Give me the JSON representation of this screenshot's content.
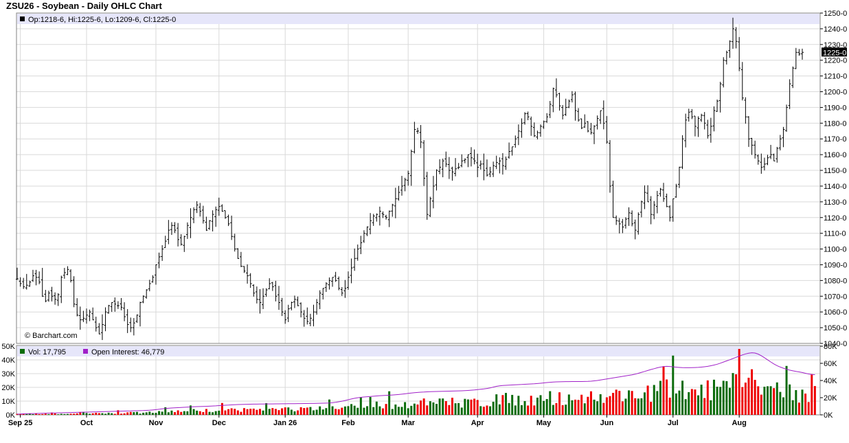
{
  "title": "ZSU26 - Soybean - Daily OHLC Chart",
  "colors": {
    "ohlc": "#000000",
    "volume_up": "#0a6b0a",
    "volume_down": "#ee0000",
    "open_interest": "#a020c8",
    "legend_bg": "#e6e6fa",
    "grid": "#d9d9d9",
    "last_price_bg": "#000000",
    "last_price_text": "#ffffff"
  },
  "price_panel": {
    "legend": "Op:1218-6, Hi:1225-6, Lo:1209-6, Cl:1225-0",
    "watermark": "© Barchart.com",
    "last_price_label": "1225-0",
    "ylim": [
      1040,
      1250
    ],
    "ticks": [
      "1040-0",
      "1050-0",
      "1060-0",
      "1070-0",
      "1080-0",
      "1090-0",
      "1100-0",
      "1110-0",
      "1120-0",
      "1130-0",
      "1140-0",
      "1150-0",
      "1160-0",
      "1170-0",
      "1180-0",
      "1190-0",
      "1200-0",
      "1210-0",
      "1220-0",
      "1230-0",
      "1240-0",
      "1250-0"
    ],
    "last_price": 1225
  },
  "volume_panel": {
    "vol_legend": "Vol: 17,795",
    "oi_legend": "Open Interest: 46,779",
    "left_ticks": [
      "0K",
      "10K",
      "20K",
      "30K",
      "40K",
      "50K"
    ],
    "right_ticks": [
      "0K",
      "20K",
      "40K",
      "60K",
      "80K"
    ],
    "vol_ylim": [
      0,
      50000
    ],
    "oi_ylim": [
      0,
      80000
    ]
  },
  "x_axis": {
    "labels": [
      "Sep 25",
      "Oct",
      "Nov",
      "Dec",
      "Jan 26",
      "Feb",
      "Mar",
      "Apr",
      "May",
      "Jun",
      "Jul",
      "Aug"
    ]
  },
  "chart_data": {
    "type": "ohlc",
    "title": "ZSU26 - Soybean - Daily OHLC Chart",
    "ylim": [
      1040,
      1250
    ],
    "grid": true,
    "legend_placement": "top-left",
    "month_start_index": {
      "Sep 25": 1,
      "Oct": 22,
      "Nov": 44,
      "Dec": 64,
      "Jan 26": 85,
      "Feb": 105,
      "Mar": 124,
      "Apr": 146,
      "May": 167,
      "Jun": 187,
      "Jul": 208,
      "Aug": 229
    },
    "close": [
      1081,
      1078,
      1076,
      1077,
      1079,
      1083,
      1082,
      1079,
      1070,
      1067,
      1072,
      1070,
      1068,
      1071,
      1082,
      1085,
      1087,
      1080,
      1065,
      1058,
      1055,
      1056,
      1058,
      1060,
      1055,
      1050,
      1046,
      1052,
      1060,
      1064,
      1066,
      1065,
      1064,
      1063,
      1057,
      1052,
      1050,
      1053,
      1058,
      1066,
      1070,
      1074,
      1078,
      1082,
      1090,
      1095,
      1100,
      1105,
      1112,
      1115,
      1112,
      1106,
      1103,
      1108,
      1115,
      1120,
      1125,
      1128,
      1124,
      1118,
      1112,
      1118,
      1122,
      1125,
      1127,
      1124,
      1120,
      1116,
      1108,
      1100,
      1094,
      1089,
      1086,
      1083,
      1078,
      1072,
      1068,
      1066,
      1070,
      1074,
      1078,
      1076,
      1070,
      1066,
      1060,
      1055,
      1062,
      1066,
      1068,
      1064,
      1060,
      1056,
      1054,
      1056,
      1060,
      1066,
      1072,
      1075,
      1078,
      1080,
      1082,
      1080,
      1075,
      1072,
      1075,
      1082,
      1088,
      1094,
      1100,
      1104,
      1110,
      1114,
      1118,
      1121,
      1122,
      1124,
      1122,
      1120,
      1124,
      1128,
      1132,
      1136,
      1140,
      1144,
      1148,
      1162,
      1176,
      1175,
      1168,
      1145,
      1122,
      1132,
      1140,
      1150,
      1152,
      1156,
      1154,
      1150,
      1149,
      1151,
      1152,
      1156,
      1157,
      1160,
      1158,
      1156,
      1152,
      1154,
      1150,
      1147,
      1149,
      1153,
      1155,
      1156,
      1153,
      1157,
      1162,
      1165,
      1170,
      1175,
      1180,
      1186,
      1184,
      1178,
      1172,
      1174,
      1178,
      1181,
      1184,
      1192,
      1202,
      1198,
      1191,
      1185,
      1190,
      1194,
      1198,
      1188,
      1182,
      1177,
      1180,
      1175,
      1174,
      1178,
      1183,
      1188,
      1180,
      1168,
      1140,
      1120,
      1118,
      1116,
      1114,
      1119,
      1123,
      1116,
      1112,
      1122,
      1130,
      1136,
      1130,
      1122,
      1128,
      1134,
      1138,
      1132,
      1127,
      1120,
      1132,
      1140,
      1152,
      1170,
      1182,
      1187,
      1184,
      1178,
      1183,
      1185,
      1180,
      1172,
      1178,
      1188,
      1194,
      1205,
      1220,
      1225,
      1232,
      1240,
      1232,
      1215,
      1196,
      1184,
      1170,
      1166,
      1160,
      1156,
      1152,
      1154,
      1158,
      1160,
      1156,
      1164,
      1170,
      1176,
      1190,
      1205,
      1215,
      1225,
      1224,
      1225
    ],
    "open_interest": [
      900,
      1000,
      1200,
      1300,
      1400,
      1500,
      1600,
      1700,
      1800,
      1900,
      2000,
      2100,
      2200,
      2300,
      2400,
      2500,
      2600,
      2700,
      2800,
      2900,
      3000,
      3100,
      3200,
      3300,
      3400,
      3500,
      3600,
      3700,
      3800,
      3900,
      4000,
      4100,
      4200,
      4300,
      4400,
      4500,
      4600,
      4700,
      4800,
      4900,
      5000,
      5200,
      5400,
      5700,
      6100,
      6500,
      7000,
      7400,
      7700,
      8000,
      8200,
      8400,
      8600,
      8800,
      9000,
      9200,
      9400,
      9600,
      9700,
      9800,
      9900,
      10100,
      10300,
      10500,
      10800,
      11000,
      11200,
      11400,
      11600,
      11800,
      12000,
      12100,
      12200,
      12300,
      12400,
      12500,
      12500,
      12600,
      12600,
      12700,
      12700,
      12700,
      12800,
      12800,
      12900,
      12900,
      13000,
      13000,
      13000,
      13100,
      13100,
      13200,
      13200,
      13300,
      13300,
      13400,
      13500,
      13600,
      13700,
      13800,
      14100,
      14600,
      15200,
      15900,
      16700,
      17600,
      18500,
      19300,
      19900,
      20400,
      20800,
      21100,
      21400,
      21700,
      22000,
      22300,
      22500,
      22700,
      22900,
      23100,
      23400,
      23700,
      24100,
      24500,
      25000,
      25400,
      25800,
      26100,
      26400,
      26600,
      26800,
      27000,
      27100,
      27200,
      27300,
      27400,
      27500,
      27600,
      27700,
      27800,
      27900,
      28000,
      28200,
      28400,
      28700,
      29000,
      29400,
      29800,
      30200,
      30700,
      31400,
      32300,
      33200,
      33800,
      34200,
      34400,
      34600,
      34800,
      35000,
      35200,
      35400,
      35600,
      35800,
      36000,
      36200,
      36500,
      36800,
      37200,
      37600,
      37900,
      38200,
      38400,
      38500,
      38600,
      38700,
      38700,
      38800,
      38800,
      38800,
      38800,
      38900,
      39000,
      39200,
      39600,
      40000,
      40600,
      41200,
      41800,
      42400,
      43000,
      43600,
      44200,
      44800,
      45400,
      46000,
      46600,
      47400,
      48400,
      49500,
      50600,
      51700,
      52800,
      53800,
      54800,
      55600,
      56200,
      56500,
      56300,
      55900,
      55500,
      55200,
      55000,
      54900,
      54900,
      55000,
      55100,
      55300,
      55600,
      56000,
      56500,
      57200,
      58000,
      59000,
      60200,
      61500,
      62800,
      64200,
      65600,
      67000,
      68400,
      69800,
      71000,
      71800,
      72300,
      72000,
      70800,
      68900,
      66600,
      64100,
      61600,
      59300,
      57300,
      55700,
      54300,
      53100,
      52100,
      51300,
      50600,
      50000,
      49300,
      48400,
      47600,
      47000,
      46779
    ],
    "volume_series_name": "Vol",
    "open_interest_series_name": "Open Interest"
  }
}
